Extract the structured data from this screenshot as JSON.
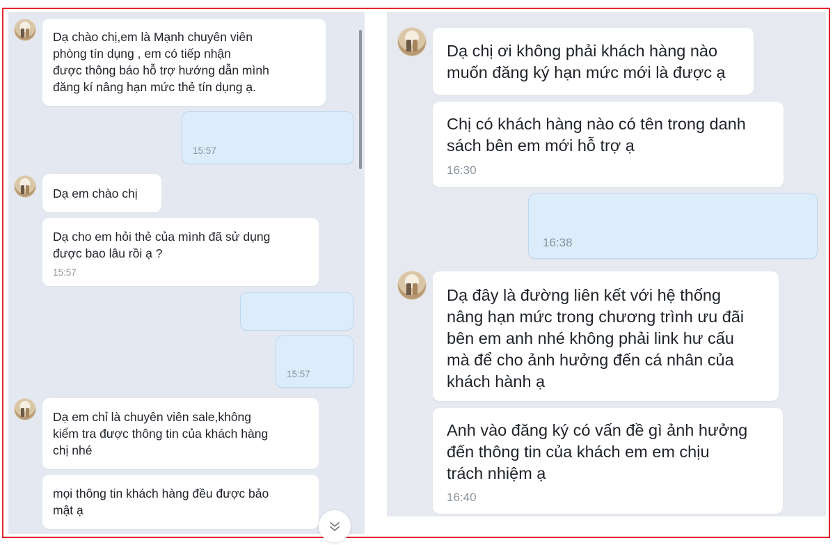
{
  "left": {
    "messages": [
      {
        "sender": "other",
        "text": "Dạ chào chị,em là Mạnh chuyên viên\nphòng tín dụng             , em có tiếp nhận\nđược thông báo hỗ trợ hướng dẫn mình\nđăng kí nâng hạn mức thẻ tín dụng ạ."
      },
      {
        "sender": "me",
        "time": "15:57"
      },
      {
        "sender": "other",
        "text": "Dạ em chào chị"
      },
      {
        "sender": "other",
        "text": "Dạ cho em hỏi thẻ của mình đã sử dụng\nđược bao lâu rồi ạ ?",
        "time": "15:57"
      },
      {
        "sender": "me"
      },
      {
        "sender": "me",
        "time": "15:57"
      },
      {
        "sender": "other",
        "text": "Dạ em chỉ là chuyên viên sale,không\nkiểm tra được thông tin của khách hàng\nchị nhé"
      },
      {
        "sender": "other",
        "text": "mọi thông tin khách hàng đều được bảo\nmật ạ"
      }
    ],
    "scroll_down_icon": "double-chevron-down-icon"
  },
  "right": {
    "messages": [
      {
        "sender": "other",
        "text": "Dạ chị ơi không phải khách hàng nào\nmuốn đăng ký hạn mức mới là được ạ"
      },
      {
        "sender": "other",
        "text": "Chị có khách hàng nào có tên trong danh\nsách bên em mới hỗ trợ ạ",
        "time": "16:30"
      },
      {
        "sender": "me",
        "time": "16:38"
      },
      {
        "sender": "other",
        "text": "Dạ đây là đường liên kết với hệ thống\nnâng hạn mức trong chương trình ưu đãi\nbên em anh nhé không phải link hư cấu\nmà để cho ảnh hưởng đến cá nhân của\nkhách hành ạ"
      },
      {
        "sender": "other",
        "text": "Anh vào đăng ký có vấn đề gì ảnh hưởng\nđến thông tin của khách em em chịu\ntrách nhiệm ạ",
        "time": "16:40"
      }
    ]
  },
  "colors": {
    "border": "#e3262d",
    "chat_background": "#e4e8f0",
    "received_bubble": "#ffffff",
    "sent_bubble": "#dcecfb"
  }
}
